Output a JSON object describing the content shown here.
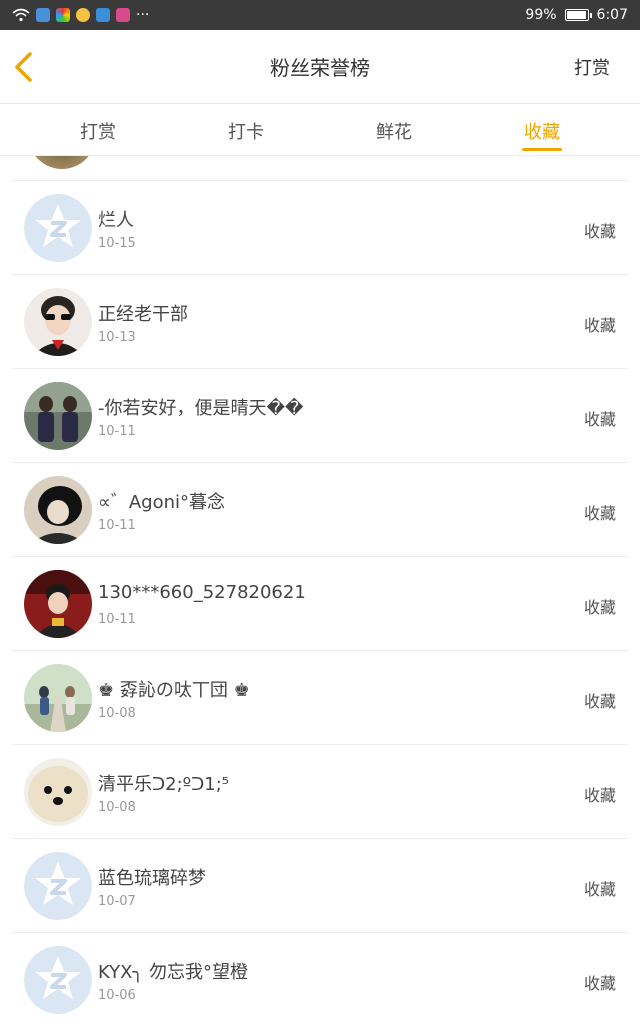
{
  "status_bar": {
    "battery": "99%",
    "time": "6:07",
    "battery_level": 0.99,
    "icons": [
      "wifi-icon",
      "app-icon",
      "app-icon",
      "app-icon",
      "app-icon",
      "app-icon"
    ],
    "more": "···"
  },
  "header": {
    "back_icon": "chevron-left-icon",
    "title": "粉丝荣誉榜",
    "right_action": "打赏"
  },
  "tabs": [
    {
      "label": "打赏",
      "active": false
    },
    {
      "label": "打卡",
      "active": false
    },
    {
      "label": "鲜花",
      "active": false
    },
    {
      "label": "收藏",
      "active": true
    }
  ],
  "accent_color": "#f0a400",
  "list": [
    {
      "name": "烂人",
      "date": "10-15",
      "action": "收藏",
      "avatar": "default-star-avatar"
    },
    {
      "name": "正经老干部",
      "date": "10-13",
      "action": "收藏",
      "avatar": "photo-avatar"
    },
    {
      "name": "-你若安好，便是晴天��",
      "date": "10-11",
      "action": "收藏",
      "avatar": "photo-avatar"
    },
    {
      "name": "∝゛Agoni°暮念",
      "date": "10-11",
      "action": "收藏",
      "avatar": "photo-avatar"
    },
    {
      "name": "130***660_527820621",
      "date": "10-11",
      "action": "收藏",
      "avatar": "photo-avatar"
    },
    {
      "name": "♚ 孬訫の呔丅団 ♚",
      "date": "10-08",
      "action": "收藏",
      "avatar": "photo-avatar"
    },
    {
      "name": "清平乐ᑐ2;ºᑐ1;⁵",
      "date": "10-08",
      "action": "收藏",
      "avatar": "dog-photo-avatar"
    },
    {
      "name": "蓝色琉璃碎梦",
      "date": "10-07",
      "action": "收藏",
      "avatar": "default-star-avatar"
    },
    {
      "name": "KYX╮ 勿忘我°望橙",
      "date": "10-06",
      "action": "收藏",
      "avatar": "default-star-avatar"
    }
  ]
}
